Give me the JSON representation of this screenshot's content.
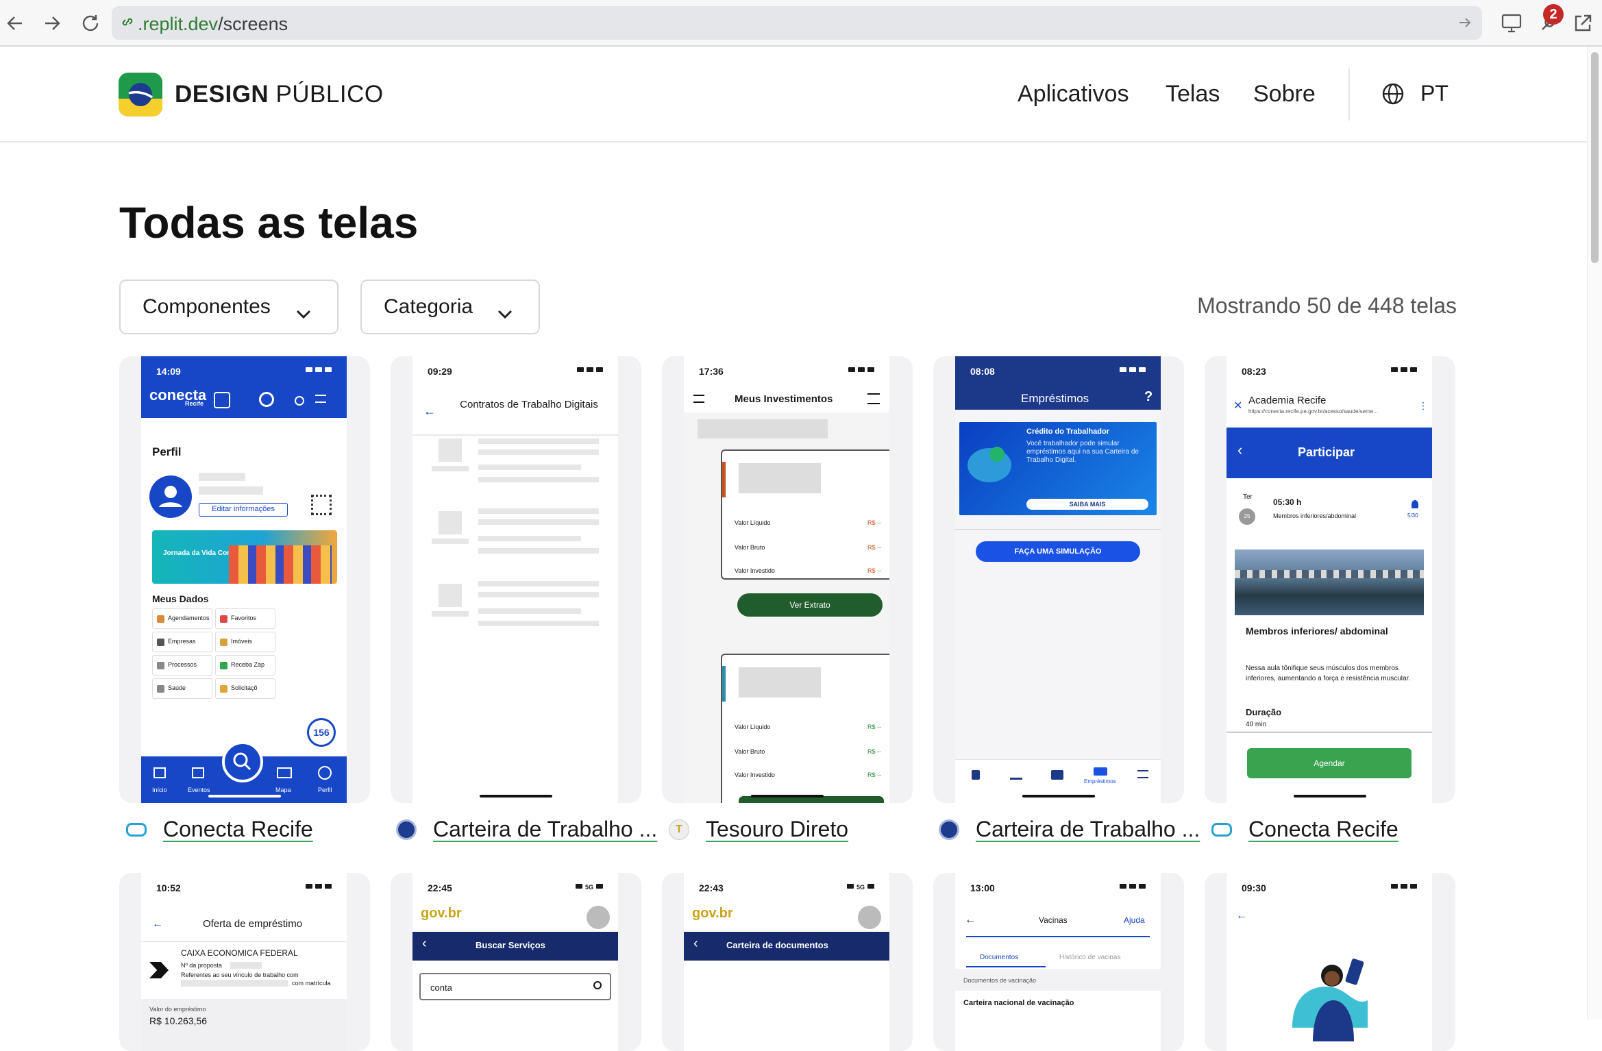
{
  "browser": {
    "url_domain": ".replit.dev",
    "url_path": "/screens",
    "notification_count": "2"
  },
  "site": {
    "brand_bold": "DESIGN",
    "brand_light": "PÚBLICO",
    "nav": [
      "Aplicativos",
      "Telas",
      "Sobre"
    ],
    "lang": "PT",
    "colors": {
      "green": "#1e9a4a",
      "yellow": "#f6cf2d",
      "blue": "#1d3c8f"
    }
  },
  "page": {
    "title": "Todas as telas",
    "filters": [
      "Componentes",
      "Categoria"
    ],
    "count_text": "Mostrando 50 de 448 telas"
  },
  "cards": [
    {
      "app": "Conecta Recife",
      "time": "14:09",
      "header_logo": "conecta",
      "header_sub": "Recife",
      "section": "Perfil",
      "edit_btn": "Editar informações",
      "banner": "Jornada da Vida Conectada",
      "my_data": "Meus Dados",
      "grid": [
        "Agendamentos",
        "Favoritos",
        "Empresas",
        "Imóveis",
        "Processos",
        "Receba Zap",
        "Saúde",
        "Solicitaçõ"
      ],
      "badge": "156",
      "tabs": [
        "Início",
        "Eventos",
        "",
        "Mapa",
        "Perfil"
      ]
    },
    {
      "app": "Carteira de Trabalho ...",
      "time": "09:29",
      "title": "Contratos de Trabalho Digitais"
    },
    {
      "app": "Tesouro Direto",
      "time": "17:36",
      "title": "Meus Investimentos",
      "rows": [
        "Valor Líquido",
        "Valor Bruto",
        "Valor Investido"
      ],
      "value": "R$ --",
      "button": "Ver Extrato"
    },
    {
      "app": "Carteira de Trabalho ...",
      "time": "08:08",
      "title": "Empréstimos",
      "help": "?",
      "banner_title": "Crédito do Trabalhador",
      "banner_text": "Você trabalhador pode simular empréstimos aqui na sua Carteira de Trabalho Digital.",
      "banner_btn": "SAIBA MAIS",
      "button": "FAÇA UMA SIMULAÇÃO",
      "tab_active": "Empréstimos"
    },
    {
      "app": "Conecta Recife",
      "time": "08:23",
      "browser_title": "Academia Recife",
      "browser_url": "https://conecta.recife.pe.gov.br/acesso/saude/seme...",
      "title": "Participar",
      "day": "Ter",
      "date": "25",
      "hour": "05:30 h",
      "desc_line": "Membros inferiores/abdominal",
      "slots": "5/30",
      "heading": "Membros inferiores/ abdominal",
      "body": "Nessa aula tônifique seus músculos dos membros inferiores, aumentando a força e resistência muscular.",
      "duration_label": "Duração",
      "duration": "40 min",
      "button": "Agendar"
    },
    {
      "time": "10:52",
      "title": "Oferta de empréstimo",
      "bank": "CAIXA ECONOMICA FEDERAL",
      "proposal": "Nº da proposta",
      "ref1": "Referentes ao seu vínculo de trabalho com",
      "ref2": "com matrícula",
      "value_label": "Valor do empréstimo",
      "value": "R$ 10.263,56"
    },
    {
      "time": "22:45",
      "net": "5G",
      "gov": "gov.br",
      "title": "Buscar Serviços",
      "search": "conta"
    },
    {
      "time": "22:43",
      "net": "5G",
      "gov": "gov.br",
      "title": "Carteira de documentos"
    },
    {
      "time": "13:00",
      "title": "Vacinas",
      "help": "Ajuda",
      "tabs": [
        "Documentos",
        "Histórico de vacinas"
      ],
      "label": "Documentos de vacinação",
      "item": "Carteira nacional de vacinação"
    },
    {
      "time": "09:30"
    }
  ]
}
